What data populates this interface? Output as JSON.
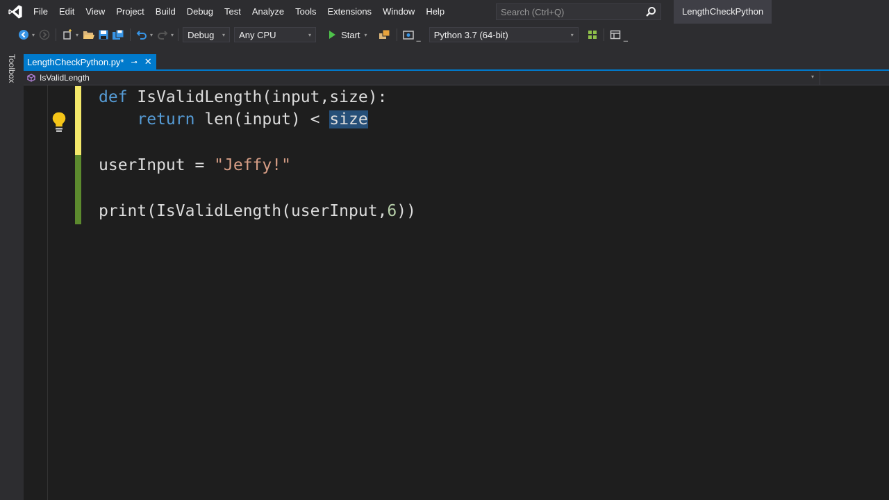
{
  "app": {
    "window_title": "LengthCheckPython",
    "logo_icon": "visual-studio-logo-icon"
  },
  "menu": {
    "items": [
      "File",
      "Edit",
      "View",
      "Project",
      "Build",
      "Debug",
      "Test",
      "Analyze",
      "Tools",
      "Extensions",
      "Window",
      "Help"
    ]
  },
  "search": {
    "placeholder": "Search (Ctrl+Q)"
  },
  "toolbar": {
    "config": "Debug",
    "platform": "Any CPU",
    "start_label": "Start",
    "environment": "Python 3.7 (64-bit)"
  },
  "sidebar": {
    "toolbox_label": "Toolbox"
  },
  "tabs": {
    "active_label": "LengthCheckPython.py*"
  },
  "navbar": {
    "member": "IsValidLength"
  },
  "editor": {
    "line1": {
      "kw": "def",
      "rest": " IsValidLength(input,size):"
    },
    "line2": {
      "indent": "    ",
      "kw": "return",
      "mid": " len(input) < ",
      "selected": "size"
    },
    "line3": {
      "ident": "userInput = ",
      "str": "\"Jeffy!\""
    },
    "line4": {
      "pre": "print(IsValidLength(userInput,",
      "num": "6",
      "post": "))"
    }
  },
  "colors": {
    "accent": "#007acc",
    "keyword": "#569cd6",
    "string": "#d69d85",
    "number": "#b5cea8",
    "selection": "#264f78",
    "unsaved_change": "#f3e86a",
    "saved_change": "#5c8a2e"
  }
}
